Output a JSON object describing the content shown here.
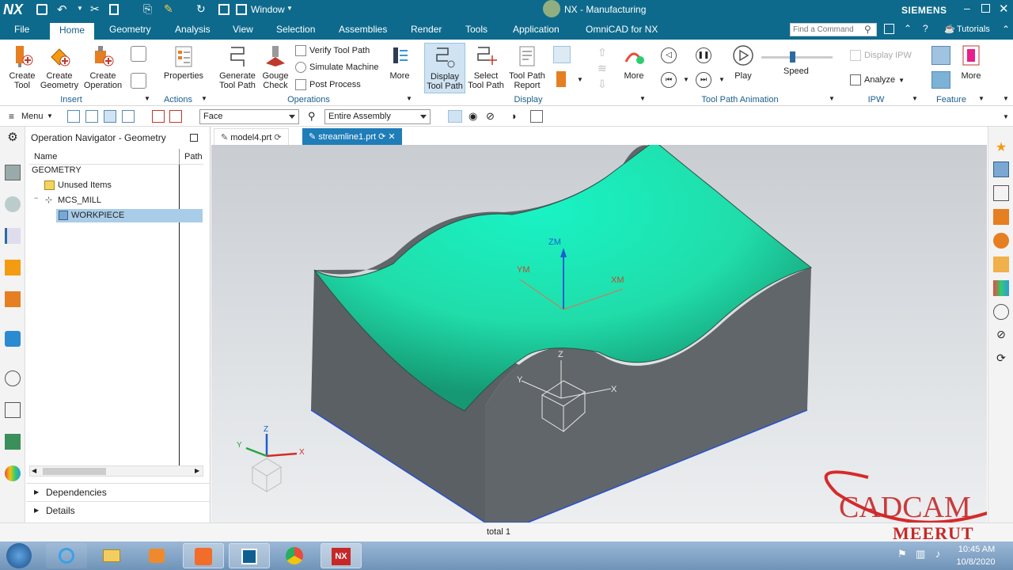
{
  "titlebar": {
    "logo": "NX",
    "window_menu": "Window",
    "title": "NX - Manufacturing",
    "brand": "SIEMENS"
  },
  "tabs": [
    "File",
    "Home",
    "Geometry",
    "Analysis",
    "View",
    "Selection",
    "Assemblies",
    "Render",
    "Tools",
    "Application",
    "OmniCAD for NX"
  ],
  "active_tab": "Home",
  "search": {
    "placeholder": "Find a Command"
  },
  "tutorials": "Tutorials",
  "ribbon": {
    "create_tool": "Create Tool",
    "create_geometry": "Create Geometry",
    "create_operation": "Create Operation",
    "properties": "Properties",
    "generate_tool_path": "Generate Tool Path",
    "gouge_check": "Gouge Check",
    "verify_tool_path": "Verify Tool Path",
    "simulate_machine": "Simulate Machine",
    "post_process": "Post Process",
    "more1": "More",
    "display_tool_path": "Display Tool Path",
    "select_tool_path": "Select Tool Path",
    "tool_path_report": "Tool Path Report",
    "more2": "More",
    "play": "Play",
    "speed": "Speed",
    "display_ipw": "Display IPW",
    "analyze": "Analyze",
    "more3": "More",
    "groups": {
      "insert": "Insert",
      "actions": "Actions",
      "operations": "Operations",
      "display": "Display",
      "animation": "Tool Path Animation",
      "ipw": "IPW",
      "feature": "Feature"
    }
  },
  "toolbar2": {
    "menu": "Menu",
    "filter": "Face",
    "scope": "Entire Assembly"
  },
  "navigator": {
    "title": "Operation Navigator - Geometry",
    "col_name": "Name",
    "col_path": "Path",
    "items": [
      "GEOMETRY",
      "Unused Items",
      "MCS_MILL",
      "WORKPIECE"
    ],
    "dependencies": "Dependencies",
    "details": "Details"
  },
  "doc_tabs": [
    "model4.prt",
    "streamline1.prt"
  ],
  "viewport": {
    "axis_zm": "ZM",
    "axis_xm": "XM",
    "axis_ym": "YM",
    "axis_z": "Z",
    "axis_x": "X",
    "axis_y": "Y",
    "triad_z": "Z",
    "triad_x": "X",
    "triad_y": "Y",
    "watermark_line1": "CADCAM",
    "watermark_line2": "MEERUT"
  },
  "status": {
    "center": "total 1"
  },
  "clock": {
    "time": "10:45 AM",
    "date": "10/8/2020"
  },
  "colors": {
    "title_blue": "#0d6a8c",
    "surface": "#1ff0b8",
    "solid": "#5d6163",
    "accent": "#c62828"
  }
}
